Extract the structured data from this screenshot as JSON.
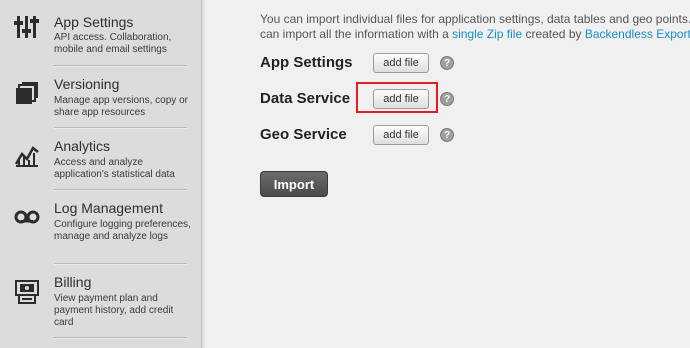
{
  "sidebar": {
    "items": [
      {
        "title": "App Settings",
        "desc": "API access. Collaboration, mobile and email settings",
        "icon": "sliders-icon"
      },
      {
        "title": "Versioning",
        "desc": "Manage app versions, copy or share app resources",
        "icon": "layers-icon"
      },
      {
        "title": "Analytics",
        "desc": "Access and analyze application's statistical data",
        "icon": "line-chart-icon"
      },
      {
        "title": "Log Management",
        "desc": "Configure logging preferences, manage and analyze logs",
        "icon": "tape-icon"
      },
      {
        "title": "Billing",
        "desc": "View payment plan and payment history, add credit card",
        "icon": "billing-icon"
      }
    ]
  },
  "main": {
    "intro_line1": "You can import individual files for application settings, data tables and geo points. A",
    "intro_line2_prefix": "can import all the information with a ",
    "intro_link1": "single Zip file",
    "intro_line2_middle": " created by ",
    "intro_link2": "Backendless Export",
    "rows": [
      {
        "label": "App Settings",
        "button": "add file",
        "help": "?"
      },
      {
        "label": "Data Service",
        "button": "add file",
        "help": "?"
      },
      {
        "label": "Geo Service",
        "button": "add file",
        "help": "?"
      }
    ],
    "import_label": "Import"
  },
  "colors": {
    "link": "#1a8fc9",
    "highlight": "#e31c23",
    "sidebar_bg": "#dcdcdc",
    "main_bg": "#f0f0f0"
  }
}
